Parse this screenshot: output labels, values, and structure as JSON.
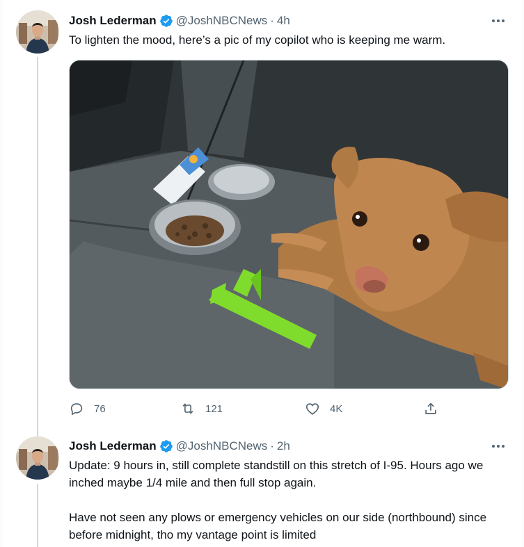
{
  "tweets": [
    {
      "author": {
        "name": "Josh Lederman",
        "handle": "@JoshNBCNews",
        "verified": true
      },
      "separator": "·",
      "time": "4h",
      "text": "To lighten the mood, here’s a pic of my copilot who is keeping me warm.",
      "media": {
        "description_icon": "photo-dog-in-car"
      },
      "actions": {
        "reply": "76",
        "retweet": "121",
        "like": "4K"
      }
    },
    {
      "author": {
        "name": "Josh Lederman",
        "handle": "@JoshNBCNews",
        "verified": true
      },
      "separator": "·",
      "time": "2h",
      "text": "Update: 9 hours in, still complete standstill on this stretch of I-95. Hours ago we inched maybe 1/4 mile and then full stop again.\n\nHave not seen any plows or emergency vehicles on our side (northbound) since before midnight, tho my vantage point is limited"
    }
  ],
  "colors": {
    "verified": "#1d9bf0",
    "secondary_text": "#536471",
    "thread_line": "#cfd9de"
  }
}
